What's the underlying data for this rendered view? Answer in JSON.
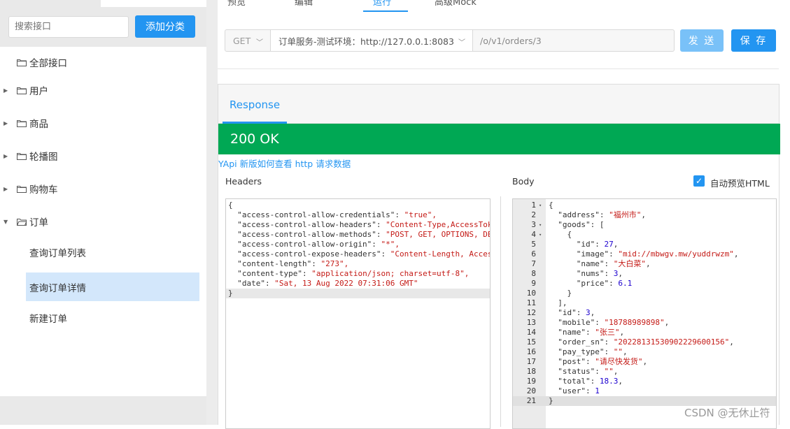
{
  "sidebar": {
    "search_placeholder": "搜索接口",
    "add_category": "添加分类",
    "all_interfaces": "全部接口",
    "categories": [
      "用户",
      "商品",
      "轮播图",
      "购物车",
      "订单"
    ],
    "sub_items": [
      "查询订单列表",
      "查询订单详情",
      "新建订单"
    ],
    "active_sub": "查询订单详情"
  },
  "main": {
    "tabs": [
      "预览",
      "编辑",
      "运行",
      "高级Mock"
    ],
    "request": {
      "method": "GET",
      "env": "订单服务-测试环境：http://127.0.0.1:8083",
      "path": "/o/v1/orders/3",
      "send": "发 送",
      "save": "保 存"
    },
    "response": {
      "tab": "Response",
      "status": "200 OK",
      "help_link": "YApi 新版如何查看 http 请求数据",
      "headers_label": "Headers",
      "body_label": "Body",
      "preview_label": "自动预览HTML"
    }
  },
  "headers_lines": [
    {
      "k": "",
      "v": "{"
    },
    {
      "k": "  \"access-control-allow-credentials\": ",
      "v": "\"true\","
    },
    {
      "k": "  \"access-control-allow-headers\": ",
      "v": "\"Content-Type,AccessTok"
    },
    {
      "k": "  \"access-control-allow-methods\": ",
      "v": "\"POST, GET, OPTIONS, DE"
    },
    {
      "k": "  \"access-control-allow-origin\": ",
      "v": "\"*\","
    },
    {
      "k": "  \"access-control-expose-headers\": ",
      "v": "\"Content-Length, Acces"
    },
    {
      "k": "  \"content-length\": ",
      "v": "\"273\","
    },
    {
      "k": "  \"content-type\": ",
      "v": "\"application/json; charset=utf-8\","
    },
    {
      "k": "  \"date\": ",
      "v": "\"Sat, 13 Aug 2022 07:31:06 GMT\""
    },
    {
      "k": "",
      "v": "}"
    }
  ],
  "body_lines": [
    {
      "n": "1",
      "f": "▾",
      "k": "{",
      "v": "",
      "t": ""
    },
    {
      "n": "2",
      "f": "",
      "k": "  \"address\": ",
      "v": "\"福州市\"",
      "t": ","
    },
    {
      "n": "3",
      "f": "▾",
      "k": "  \"goods\": [",
      "v": "",
      "t": ""
    },
    {
      "n": "4",
      "f": "▾",
      "k": "    {",
      "v": "",
      "t": ""
    },
    {
      "n": "5",
      "f": "",
      "k": "      \"id\": ",
      "v": "27",
      "t": ","
    },
    {
      "n": "6",
      "f": "",
      "k": "      \"image\": ",
      "v": "\"mid://mbwgv.mw/yuddrwzm\"",
      "t": ","
    },
    {
      "n": "7",
      "f": "",
      "k": "      \"name\": ",
      "v": "\"大白菜\"",
      "t": ","
    },
    {
      "n": "8",
      "f": "",
      "k": "      \"nums\": ",
      "v": "3",
      "t": ","
    },
    {
      "n": "9",
      "f": "",
      "k": "      \"price\": ",
      "v": "6.1",
      "t": ""
    },
    {
      "n": "10",
      "f": "",
      "k": "    }",
      "v": "",
      "t": ""
    },
    {
      "n": "11",
      "f": "",
      "k": "  ],",
      "v": "",
      "t": ""
    },
    {
      "n": "12",
      "f": "",
      "k": "  \"id\": ",
      "v": "3",
      "t": ","
    },
    {
      "n": "13",
      "f": "",
      "k": "  \"mobile\": ",
      "v": "\"18788989898\"",
      "t": ","
    },
    {
      "n": "14",
      "f": "",
      "k": "  \"name\": ",
      "v": "\"张三\"",
      "t": ","
    },
    {
      "n": "15",
      "f": "",
      "k": "  \"order_sn\": ",
      "v": "\"20228131530902229600156\"",
      "t": ","
    },
    {
      "n": "16",
      "f": "",
      "k": "  \"pay_type\": ",
      "v": "\"\"",
      "t": ","
    },
    {
      "n": "17",
      "f": "",
      "k": "  \"post\": ",
      "v": "\"请尽快发货\"",
      "t": ","
    },
    {
      "n": "18",
      "f": "",
      "k": "  \"status\": ",
      "v": "\"\"",
      "t": ","
    },
    {
      "n": "19",
      "f": "",
      "k": "  \"total\": ",
      "v": "18.3",
      "t": ","
    },
    {
      "n": "20",
      "f": "",
      "k": "  \"user\": ",
      "v": "1",
      "t": ""
    },
    {
      "n": "21",
      "f": "",
      "k": "}",
      "v": "",
      "t": ""
    }
  ],
  "watermark": "CSDN @无休止符",
  "colors": {
    "accent": "#2395f1",
    "status_ok": "#00a854",
    "active_item": "#d3e7fb"
  }
}
